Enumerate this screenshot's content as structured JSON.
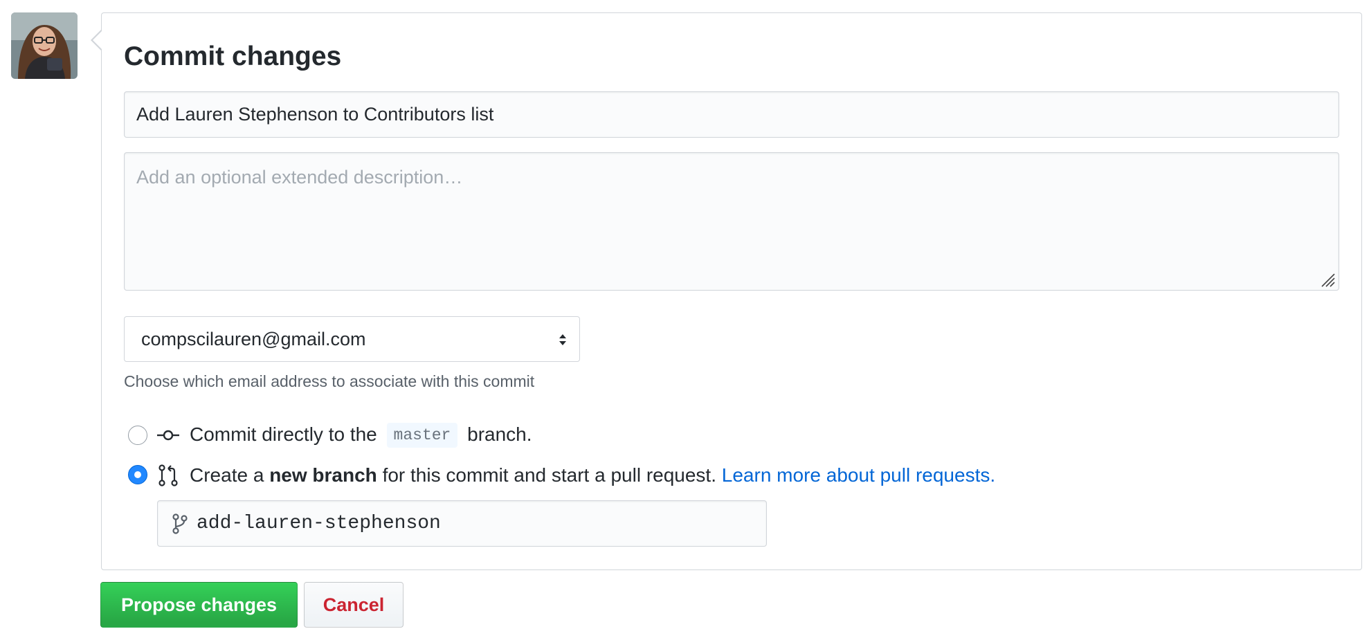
{
  "commit": {
    "title": "Commit changes",
    "summary_value": "Add Lauren Stephenson to Contributors list",
    "description_placeholder": "Add an optional extended description…",
    "email_value": "compscilauren@gmail.com",
    "email_note": "Choose which email address to associate with this commit",
    "options": {
      "direct": {
        "prefix": "Commit directly to the",
        "branch": "master",
        "suffix": "branch.",
        "selected": false
      },
      "new_branch": {
        "prefix": "Create a",
        "bold": "new branch",
        "middle": "for this commit and start a pull request.",
        "link": "Learn more about pull requests.",
        "selected": true
      }
    },
    "branch_name": "add-lauren-stephenson",
    "buttons": {
      "propose": "Propose changes",
      "cancel": "Cancel"
    }
  },
  "icons": {
    "avatar": "user-avatar",
    "commit": "git-commit-icon",
    "pull_request": "git-pull-request-icon",
    "branch": "git-branch-icon",
    "select_arrows": "select-arrows-icon"
  },
  "colors": {
    "primary_button": "#28a745",
    "danger_text": "#cb2431",
    "link": "#0366d6",
    "radio_selected": "#2188ff"
  }
}
